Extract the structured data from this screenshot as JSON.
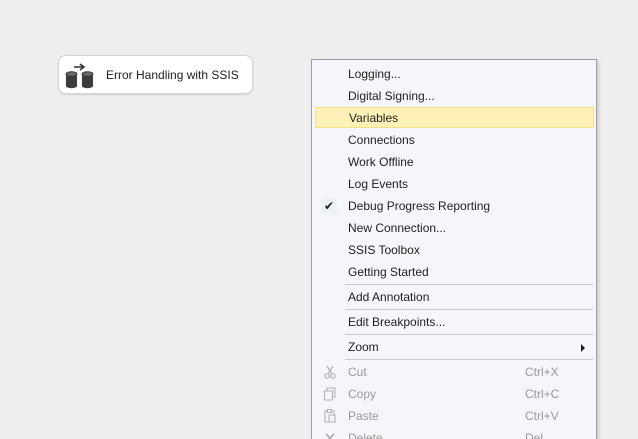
{
  "task": {
    "label": "Error Handling with SSIS",
    "icon": "data-flow-task-icon"
  },
  "context_menu": {
    "items": [
      {
        "label": "Logging...",
        "state": "normal"
      },
      {
        "label": "Digital Signing...",
        "state": "normal"
      },
      {
        "label": "Variables",
        "state": "highlighted"
      },
      {
        "label": "Connections",
        "state": "normal"
      },
      {
        "label": "Work Offline",
        "state": "normal"
      },
      {
        "label": "Log Events",
        "state": "normal"
      },
      {
        "label": "Debug Progress Reporting",
        "state": "checked",
        "check_mark": "✔"
      },
      {
        "label": "New Connection...",
        "state": "normal"
      },
      {
        "label": "SSIS Toolbox",
        "state": "normal"
      },
      {
        "label": "Getting Started",
        "state": "normal"
      },
      {
        "label": "Add Annotation",
        "state": "normal"
      },
      {
        "label": "Edit Breakpoints...",
        "state": "normal"
      },
      {
        "label": "Zoom",
        "state": "submenu"
      },
      {
        "label": "Cut",
        "shortcut": "Ctrl+X",
        "state": "disabled",
        "icon": "scissors-icon"
      },
      {
        "label": "Copy",
        "shortcut": "Ctrl+C",
        "state": "disabled",
        "icon": "copy-icon"
      },
      {
        "label": "Paste",
        "shortcut": "Ctrl+V",
        "state": "disabled",
        "icon": "paste-icon"
      },
      {
        "label": "Delete",
        "shortcut": "Del",
        "state": "disabled",
        "icon": "delete-icon"
      }
    ]
  },
  "colors": {
    "background": "#eeeeef",
    "menu_background": "#f5f6fb",
    "highlight": "#fff2b8",
    "disabled_text": "#9a9a9a"
  }
}
